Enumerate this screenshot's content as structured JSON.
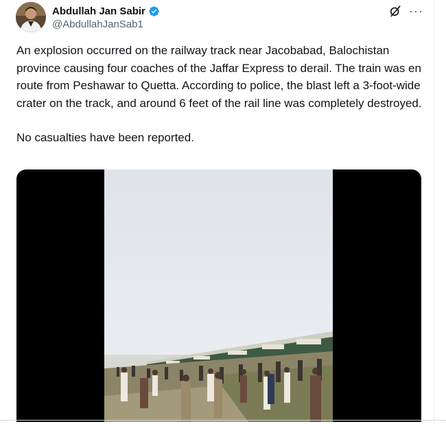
{
  "author": {
    "name": "Abdullah Jan Sabir",
    "handle": "@AbdullahJanSab1",
    "verified": true,
    "verified_color": "#1d9bf0"
  },
  "header_icons": {
    "grok": "grok-icon",
    "more": "more-icon",
    "more_label": "···"
  },
  "tweet": {
    "paragraph_1": "An explosion occurred on the railway track near Jacobabad, Balochistan province causing four coaches of the Jaffar Express to derail. The train was en route from Peshawar to Quetta. According to police, the blast left a 3-foot-wide crater on the track, and around 6 feet of the rail line was completely destroyed.",
    "paragraph_2": "No casualties have been reported."
  },
  "media": {
    "type": "video",
    "background": "#000000"
  },
  "colors": {
    "text": "#0f1419",
    "secondary": "#536471"
  }
}
